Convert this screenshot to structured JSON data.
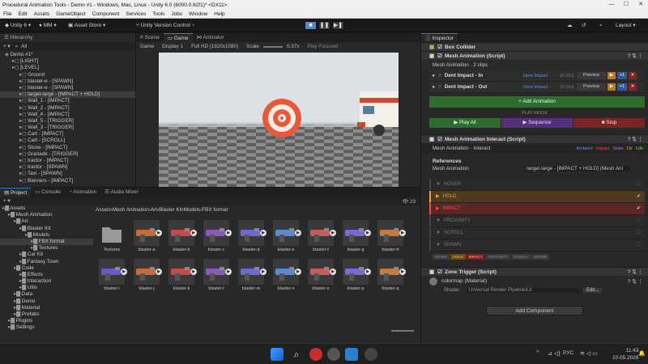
{
  "window": {
    "title": "Procedural Animation Tools - Demo #1 - Windows, Mac, Linux - Unity 6.0 (6000.0.62f1)* <DX11>"
  },
  "menu": [
    "File",
    "Edit",
    "Assets",
    "GameObject",
    "Component",
    "Services",
    "Tools",
    "Jobs",
    "Window",
    "Help"
  ],
  "toolbar": {
    "unity": "Unity 6",
    "account": "MM",
    "asset_store": "Asset Store",
    "version_control": "Unity Version Control",
    "layout": "Layout"
  },
  "hierarchy": {
    "tab": "Hierarchy",
    "search": "All",
    "items": [
      {
        "label": "Demo #1*",
        "indent": 0
      },
      {
        "label": "[LIGHT]",
        "indent": 1
      },
      {
        "label": "[LEVEL]",
        "indent": 1
      },
      {
        "label": "Ground",
        "indent": 2
      },
      {
        "label": "blaster-e - [SPAWN]",
        "indent": 2
      },
      {
        "label": "blaster-e - [SPAWN]",
        "indent": 2
      },
      {
        "label": "target-large - [IMPACT + HOLD]",
        "indent": 2,
        "selected": true
      },
      {
        "label": "Wall_1 - [IMPACT]",
        "indent": 2
      },
      {
        "label": "Wall_2 - [IMPACT]",
        "indent": 2
      },
      {
        "label": "Wall_4 - [IMPACT]",
        "indent": 2
      },
      {
        "label": "Wall_5 - [TRIGGER]",
        "indent": 2
      },
      {
        "label": "Wall_3 - [TRIGGER]",
        "indent": 2
      },
      {
        "label": "Cart - [IMPACT]",
        "indent": 2
      },
      {
        "label": "Cart - [SCROLL]",
        "indent": 2
      },
      {
        "label": "Stone - [IMPACT]",
        "indent": 2
      },
      {
        "label": "Granade - [TRIGGER]",
        "indent": 2
      },
      {
        "label": "tractor - [IMPACT]",
        "indent": 2
      },
      {
        "label": "tractor - [SPAWN]",
        "indent": 2
      },
      {
        "label": "Taxi - [SPAWN]",
        "indent": 2
      },
      {
        "label": "Banners - [IMPACT]",
        "indent": 2
      }
    ]
  },
  "view_tabs": {
    "scene": "Scene",
    "game": "Game",
    "animator": "Animator"
  },
  "game_bar": {
    "mode": "Game",
    "display": "Display 1",
    "resolution": "Full HD (1920x1080)",
    "scale_label": "Scale",
    "scale": "0.37x",
    "play_focused": "Play Focused"
  },
  "bottom_tabs": {
    "project": "Project",
    "console": "Console",
    "animation": "Animation",
    "audio_mixer": "Audio Mixer",
    "count": "29"
  },
  "project_tree": [
    {
      "label": "Assets",
      "indent": 0
    },
    {
      "label": "Mesh Animation",
      "indent": 1
    },
    {
      "label": "Art",
      "indent": 2
    },
    {
      "label": "Blaster Kit",
      "indent": 3
    },
    {
      "label": "Models",
      "indent": 4
    },
    {
      "label": "FBX format",
      "indent": 5,
      "selected": true
    },
    {
      "label": "Textures",
      "indent": 5
    },
    {
      "label": "Car Kit",
      "indent": 3
    },
    {
      "label": "Fantasy Town",
      "indent": 3
    },
    {
      "label": "Code",
      "indent": 2
    },
    {
      "label": "Effects",
      "indent": 3
    },
    {
      "label": "Interaction",
      "indent": 3
    },
    {
      "label": "Utils",
      "indent": 3
    },
    {
      "label": "Data",
      "indent": 2
    },
    {
      "label": "Demo",
      "indent": 2
    },
    {
      "label": "Material",
      "indent": 2
    },
    {
      "label": "Prefabs",
      "indent": 2
    },
    {
      "label": "Plugins",
      "indent": 1
    },
    {
      "label": "Settings",
      "indent": 1
    }
  ],
  "breadcrumb": [
    "Assets",
    "Mesh Animation",
    "Art",
    "Blaster Kit",
    "Models",
    "FBX format"
  ],
  "assets_row1": [
    "Textures",
    "blaster-a",
    "blaster-b",
    "blaster-c",
    "blaster-d",
    "blaster-e",
    "blaster-f",
    "blaster-g",
    "blaster-h"
  ],
  "assets_row2": [
    "blaster-i",
    "blaster-j",
    "blaster-k",
    "blaster-l",
    "blaster-m",
    "blaster-n",
    "blaster-o",
    "blaster-p",
    "blaster-q"
  ],
  "inspector": {
    "tab": "Inspector",
    "box_collider": "Box Collider",
    "mesh_anim": {
      "title": "Mesh Animation (Script)",
      "clips_label": "Mesh Animation · 2 clips",
      "clips": [
        {
          "name": "Dent Impact - In",
          "type": "Dent Impact",
          "dur": "[0.25s]"
        },
        {
          "name": "Dent Impact - Out",
          "type": "Dent Impact",
          "dur": "[0.50s]"
        }
      ],
      "preview": "Preview",
      "plus": "+1",
      "add": "+ Add Animation",
      "play_mode": "PLAY MODE",
      "play_all": "Play All",
      "sequence": "Sequence",
      "stop": "Stop"
    },
    "interact": {
      "title": "Mesh Animation Interact (Script)",
      "sub": "Mesh Animation · Interact",
      "tags": [
        "Ambient",
        "Impact",
        "State",
        "Dir",
        "Life"
      ],
      "references": "References",
      "ref_label": "Mesh Animation",
      "ref_value": "target-large - [IMPACT + HOLD] (Mesh Ani",
      "states": [
        {
          "name": "HOVER",
          "on": false
        },
        {
          "name": "HOLD",
          "on": true,
          "color": "#e8a040"
        },
        {
          "name": "IMPACT",
          "on": true,
          "color": "#e85050"
        },
        {
          "name": "PROXIMITY",
          "on": false
        },
        {
          "name": "SCROLL",
          "on": false
        },
        {
          "name": "SPAWN",
          "on": false
        }
      ],
      "pills": [
        "ENTER",
        "HOLD",
        "IMPACT",
        "PROXIMITY",
        "SCROLL",
        "SPAWN"
      ]
    },
    "zone": {
      "title": "Zone Trigger (Script)",
      "material": "colormap (Material)",
      "shader_label": "Shader",
      "shader": "Universal Render Pipeline/Lit",
      "edit": "Edit..."
    },
    "add_component": "Add Component"
  },
  "taskbar": {
    "lang": "РУС",
    "time": "11:43",
    "date": "10.05.2026"
  }
}
